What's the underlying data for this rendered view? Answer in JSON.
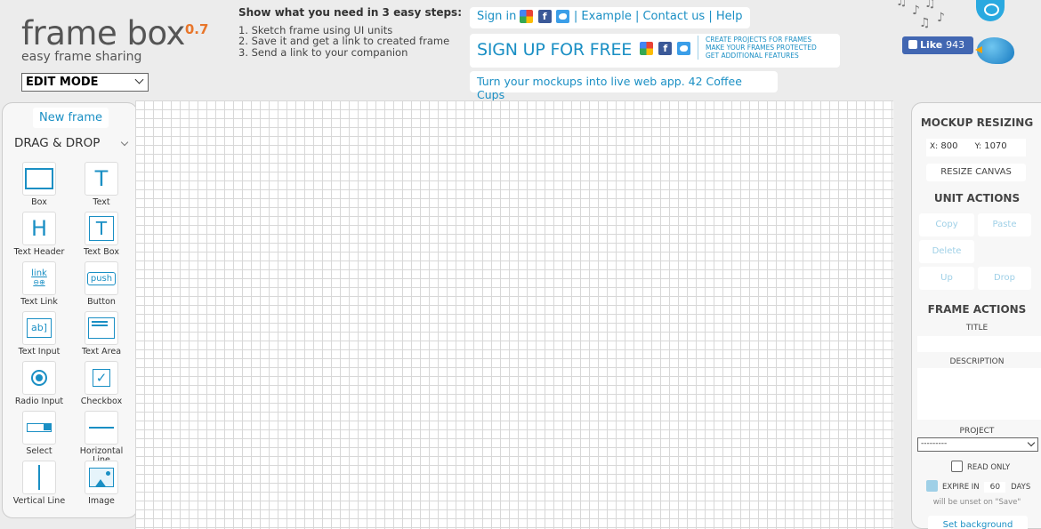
{
  "header": {
    "logo_title": "frame box",
    "logo_version": "0.7",
    "logo_tagline": "easy frame sharing",
    "mode_select": "EDIT MODE",
    "steps_title": "Show what you need in 3 easy steps:",
    "steps": [
      "1. Sketch frame using UI units",
      "2. Save it and get a link to created frame",
      "3. Send a link to your companion"
    ],
    "signin_label": "Sign in",
    "nav_links": [
      "Example",
      "Contact us",
      "Help"
    ],
    "signup_label": "SIGN UP FOR FREE",
    "signup_perks": [
      "CREATE PROJECTS FOR FRAMES",
      "MAKE YOUR FRAMES PROTECTED",
      "GET ADDITIONAL FEATURES"
    ],
    "coffee_link": "Turn your mockups into live web app. 42 Coffee Cups",
    "like_label": "Like",
    "like_count": "943"
  },
  "left_panel": {
    "new_frame": "New frame",
    "section": "DRAG & DROP",
    "tools": [
      {
        "label": "Box",
        "icon": "box-icon"
      },
      {
        "label": "Text",
        "icon": "text-icon"
      },
      {
        "label": "Text Header",
        "icon": "text-header-icon"
      },
      {
        "label": "Text Box",
        "icon": "text-box-icon"
      },
      {
        "label": "Text Link",
        "icon": "text-link-icon"
      },
      {
        "label": "Button",
        "icon": "button-icon"
      },
      {
        "label": "Text Input",
        "icon": "text-input-icon"
      },
      {
        "label": "Text Area",
        "icon": "text-area-icon"
      },
      {
        "label": "Radio Input",
        "icon": "radio-icon"
      },
      {
        "label": "Checkbox",
        "icon": "checkbox-icon"
      },
      {
        "label": "Select",
        "icon": "select-icon"
      },
      {
        "label": "Horizontal Line",
        "icon": "horizontal-line-icon"
      },
      {
        "label": "Vertical Line",
        "icon": "vertical-line-icon"
      },
      {
        "label": "Image",
        "icon": "image-icon"
      }
    ],
    "icon_glyphs": {
      "text": "T",
      "header": "H",
      "textbox": "T",
      "link": "link",
      "link_sub": "⊖⊕",
      "push": "push",
      "input": "ab]",
      "check": "✓"
    }
  },
  "right_panel": {
    "resize_title": "MOCKUP RESIZING",
    "x_label": "X:",
    "x_value": "800",
    "y_label": "Y:",
    "y_value": "1070",
    "resize_button": "RESIZE CANVAS",
    "unit_title": "UNIT ACTIONS",
    "unit_buttons": [
      "Copy",
      "Paste",
      "Delete",
      "Up",
      "Drop"
    ],
    "frame_title": "FRAME ACTIONS",
    "title_label": "TITLE",
    "description_label": "DESCRIPTION",
    "project_label": "PROJECT",
    "project_value": "---------",
    "read_only_label": "READ ONLY",
    "read_only_checked": false,
    "expire_label": "EXPIRE IN",
    "expire_value": "60",
    "expire_unit": "DAYS",
    "expire_checked": true,
    "expire_note": "will be unset on \"Save\"",
    "bottom_button": "Set background"
  },
  "colors": {
    "accent": "#1a8fc4",
    "logo_version": "#e8762b",
    "facebook": "#4267b2"
  }
}
